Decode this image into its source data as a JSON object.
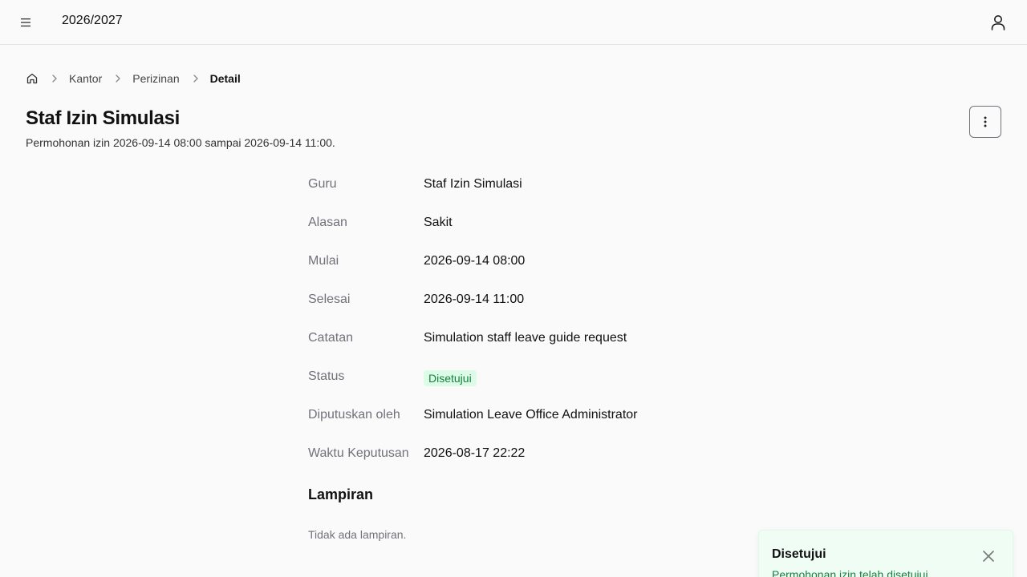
{
  "header": {
    "menu_icon": "hamburger-menu-icon",
    "academic_year": "2026/2027",
    "user_icon": "user-icon"
  },
  "breadcrumb": {
    "home_icon": "home-icon",
    "items": [
      "Kantor",
      "Perizinan"
    ],
    "current": "Detail"
  },
  "page": {
    "title": "Staf Izin Simulasi",
    "subtitle": "Permohonan izin 2026-09-14 08:00 sampai 2026-09-14 11:00.",
    "more_icon": "more-vertical-icon"
  },
  "details": [
    {
      "label": "Guru",
      "value": "Staf Izin Simulasi"
    },
    {
      "label": "Alasan",
      "value": "Sakit"
    },
    {
      "label": "Mulai",
      "value": "2026-09-14 08:00"
    },
    {
      "label": "Selesai",
      "value": "2026-09-14 11:00"
    },
    {
      "label": "Catatan",
      "value": "Simulation staff leave guide request"
    },
    {
      "label": "Status",
      "value": "Disetujui",
      "badge_color": "#15803d",
      "badge_bg": "#dcfce7"
    },
    {
      "label": "Diputuskan oleh",
      "value": "Simulation Leave Office Administrator"
    },
    {
      "label": "Waktu Keputusan",
      "value": "2026-08-17 22:22"
    }
  ],
  "attachments": {
    "title": "Lampiran",
    "empty_text": "Tidak ada lampiran."
  },
  "toast": {
    "title": "Disetujui",
    "message": "Permohonan izin telah disetujui.",
    "close_icon": "close-icon",
    "accent": "#15803d"
  }
}
